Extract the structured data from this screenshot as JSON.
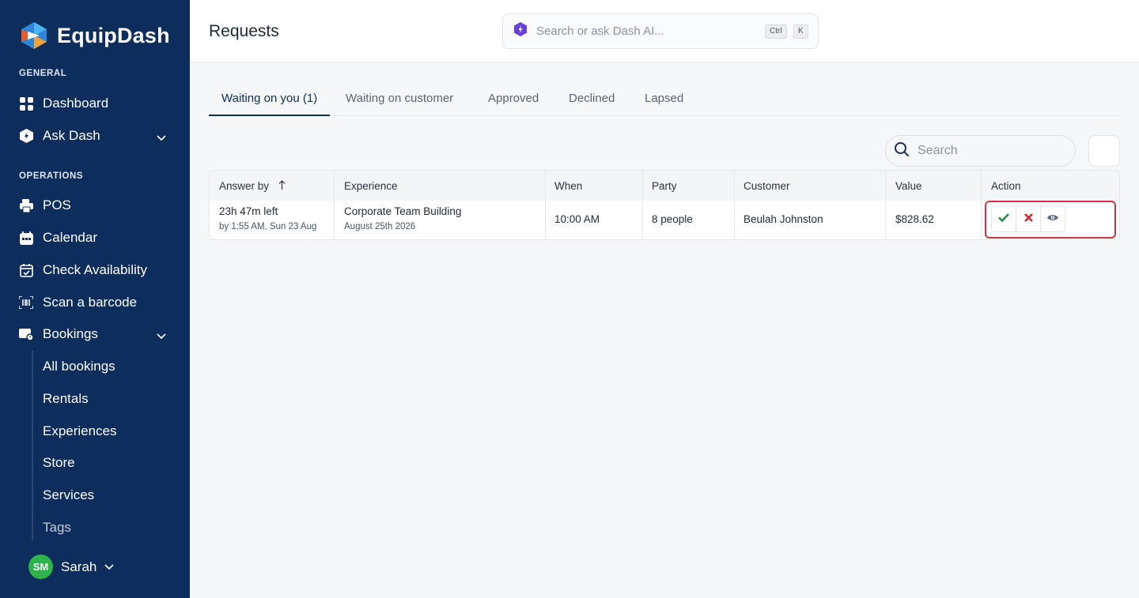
{
  "app": {
    "name": "EquipDash"
  },
  "sidebar": {
    "general_label": "GENERAL",
    "general_items": [
      {
        "label": "Dashboard",
        "icon": "grid-icon"
      },
      {
        "label": "Ask Dash",
        "icon": "hex-bolt-icon"
      }
    ],
    "operations_label": "OPERATIONS",
    "operations_items": [
      {
        "label": "POS",
        "icon": "printer-icon"
      },
      {
        "label": "Calendar",
        "icon": "calendar-icon"
      },
      {
        "label": "Check Availability",
        "icon": "calendar-check-icon"
      },
      {
        "label": "Scan a barcode",
        "icon": "barcode-icon"
      },
      {
        "label": "Bookings",
        "icon": "bookings-icon"
      }
    ],
    "booking_subitems": [
      "All bookings",
      "Rentals",
      "Experiences",
      "Store",
      "Services",
      "Tags"
    ],
    "user": {
      "initials": "SM",
      "name": "Sarah"
    }
  },
  "header": {
    "title": "Requests",
    "search_placeholder": "Search or ask Dash AI...",
    "shortcut": [
      "Ctrl",
      "K"
    ]
  },
  "tabs": [
    "Waiting on you (1)",
    "Waiting on customer",
    "Approved",
    "Declined",
    "Lapsed"
  ],
  "table_search_placeholder": "Search",
  "table": {
    "columns": [
      "Answer by",
      "Experience",
      "When",
      "Party",
      "Customer",
      "Value",
      "Action"
    ],
    "rows": [
      {
        "answer_by": "23h 47m left",
        "answer_by_sub": "by 1:55 AM, Sun 23 Aug",
        "experience": "Corporate Team Building",
        "experience_sub": "August 25th 2026",
        "when": "10:00 AM",
        "party": "8 people",
        "customer": "Beulah Johnston",
        "value": "$828.62"
      }
    ]
  },
  "colors": {
    "sidebar": "#0d2d5c",
    "approve": "#1f8a3a",
    "decline": "#d0202b",
    "highlight": "#d23340",
    "avatar": "#2db34a"
  }
}
